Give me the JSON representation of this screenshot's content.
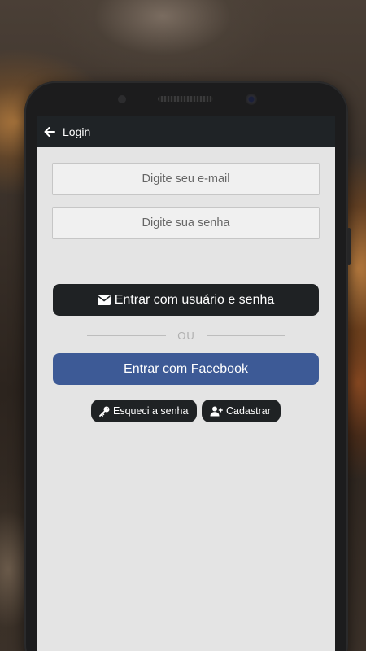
{
  "appbar": {
    "title": "Login",
    "back_icon": "arrow-left-icon"
  },
  "form": {
    "email_placeholder": "Digite seu e-mail",
    "password_placeholder": "Digite sua senha",
    "login_button_label": "Entrar com usuário e senha",
    "login_button_icon": "envelope-icon",
    "divider_text": "OU",
    "facebook_button_label": "Entrar com Facebook",
    "forgot_password_label": "Esqueci a senha",
    "forgot_password_icon": "key-icon",
    "register_label": "Cadastrar",
    "register_icon": "user-plus-icon"
  },
  "colors": {
    "appbar_bg": "#1f2326",
    "dark_button": "#1f2224",
    "facebook_blue": "#3d5a96",
    "screen_bg": "#e4e4e4"
  }
}
